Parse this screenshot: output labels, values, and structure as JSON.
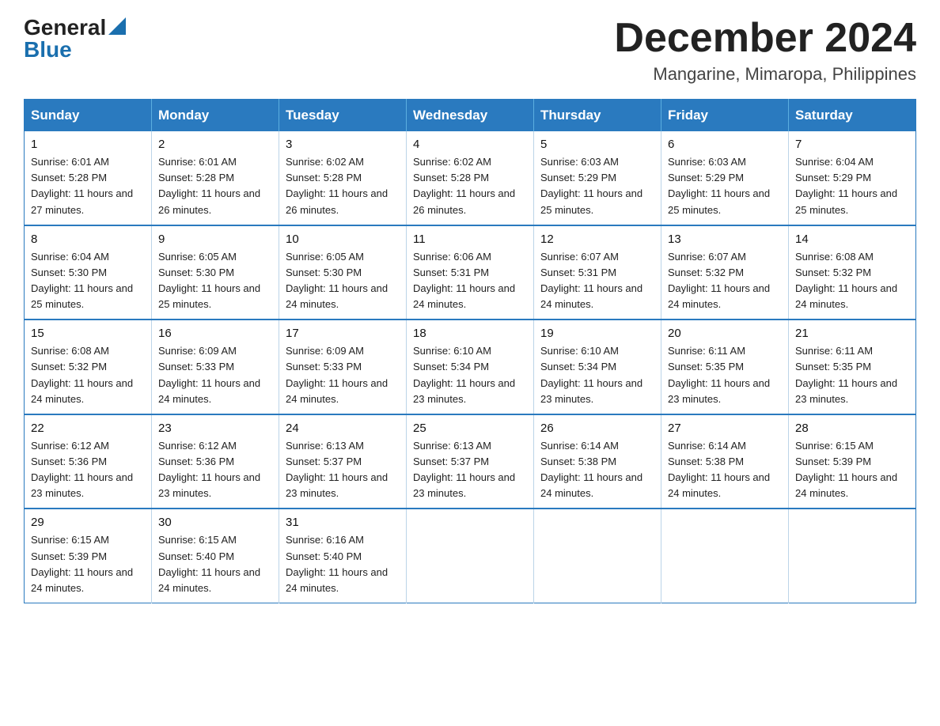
{
  "logo": {
    "general": "General",
    "blue": "Blue"
  },
  "title": "December 2024",
  "location": "Mangarine, Mimaropa, Philippines",
  "weekdays": [
    "Sunday",
    "Monday",
    "Tuesday",
    "Wednesday",
    "Thursday",
    "Friday",
    "Saturday"
  ],
  "weeks": [
    [
      {
        "day": "1",
        "sunrise": "6:01 AM",
        "sunset": "5:28 PM",
        "daylight": "11 hours and 27 minutes."
      },
      {
        "day": "2",
        "sunrise": "6:01 AM",
        "sunset": "5:28 PM",
        "daylight": "11 hours and 26 minutes."
      },
      {
        "day": "3",
        "sunrise": "6:02 AM",
        "sunset": "5:28 PM",
        "daylight": "11 hours and 26 minutes."
      },
      {
        "day": "4",
        "sunrise": "6:02 AM",
        "sunset": "5:28 PM",
        "daylight": "11 hours and 26 minutes."
      },
      {
        "day": "5",
        "sunrise": "6:03 AM",
        "sunset": "5:29 PM",
        "daylight": "11 hours and 25 minutes."
      },
      {
        "day": "6",
        "sunrise": "6:03 AM",
        "sunset": "5:29 PM",
        "daylight": "11 hours and 25 minutes."
      },
      {
        "day": "7",
        "sunrise": "6:04 AM",
        "sunset": "5:29 PM",
        "daylight": "11 hours and 25 minutes."
      }
    ],
    [
      {
        "day": "8",
        "sunrise": "6:04 AM",
        "sunset": "5:30 PM",
        "daylight": "11 hours and 25 minutes."
      },
      {
        "day": "9",
        "sunrise": "6:05 AM",
        "sunset": "5:30 PM",
        "daylight": "11 hours and 25 minutes."
      },
      {
        "day": "10",
        "sunrise": "6:05 AM",
        "sunset": "5:30 PM",
        "daylight": "11 hours and 24 minutes."
      },
      {
        "day": "11",
        "sunrise": "6:06 AM",
        "sunset": "5:31 PM",
        "daylight": "11 hours and 24 minutes."
      },
      {
        "day": "12",
        "sunrise": "6:07 AM",
        "sunset": "5:31 PM",
        "daylight": "11 hours and 24 minutes."
      },
      {
        "day": "13",
        "sunrise": "6:07 AM",
        "sunset": "5:32 PM",
        "daylight": "11 hours and 24 minutes."
      },
      {
        "day": "14",
        "sunrise": "6:08 AM",
        "sunset": "5:32 PM",
        "daylight": "11 hours and 24 minutes."
      }
    ],
    [
      {
        "day": "15",
        "sunrise": "6:08 AM",
        "sunset": "5:32 PM",
        "daylight": "11 hours and 24 minutes."
      },
      {
        "day": "16",
        "sunrise": "6:09 AM",
        "sunset": "5:33 PM",
        "daylight": "11 hours and 24 minutes."
      },
      {
        "day": "17",
        "sunrise": "6:09 AM",
        "sunset": "5:33 PM",
        "daylight": "11 hours and 24 minutes."
      },
      {
        "day": "18",
        "sunrise": "6:10 AM",
        "sunset": "5:34 PM",
        "daylight": "11 hours and 23 minutes."
      },
      {
        "day": "19",
        "sunrise": "6:10 AM",
        "sunset": "5:34 PM",
        "daylight": "11 hours and 23 minutes."
      },
      {
        "day": "20",
        "sunrise": "6:11 AM",
        "sunset": "5:35 PM",
        "daylight": "11 hours and 23 minutes."
      },
      {
        "day": "21",
        "sunrise": "6:11 AM",
        "sunset": "5:35 PM",
        "daylight": "11 hours and 23 minutes."
      }
    ],
    [
      {
        "day": "22",
        "sunrise": "6:12 AM",
        "sunset": "5:36 PM",
        "daylight": "11 hours and 23 minutes."
      },
      {
        "day": "23",
        "sunrise": "6:12 AM",
        "sunset": "5:36 PM",
        "daylight": "11 hours and 23 minutes."
      },
      {
        "day": "24",
        "sunrise": "6:13 AM",
        "sunset": "5:37 PM",
        "daylight": "11 hours and 23 minutes."
      },
      {
        "day": "25",
        "sunrise": "6:13 AM",
        "sunset": "5:37 PM",
        "daylight": "11 hours and 23 minutes."
      },
      {
        "day": "26",
        "sunrise": "6:14 AM",
        "sunset": "5:38 PM",
        "daylight": "11 hours and 24 minutes."
      },
      {
        "day": "27",
        "sunrise": "6:14 AM",
        "sunset": "5:38 PM",
        "daylight": "11 hours and 24 minutes."
      },
      {
        "day": "28",
        "sunrise": "6:15 AM",
        "sunset": "5:39 PM",
        "daylight": "11 hours and 24 minutes."
      }
    ],
    [
      {
        "day": "29",
        "sunrise": "6:15 AM",
        "sunset": "5:39 PM",
        "daylight": "11 hours and 24 minutes."
      },
      {
        "day": "30",
        "sunrise": "6:15 AM",
        "sunset": "5:40 PM",
        "daylight": "11 hours and 24 minutes."
      },
      {
        "day": "31",
        "sunrise": "6:16 AM",
        "sunset": "5:40 PM",
        "daylight": "11 hours and 24 minutes."
      },
      null,
      null,
      null,
      null
    ]
  ],
  "labels": {
    "sunrise": "Sunrise:",
    "sunset": "Sunset:",
    "daylight": "Daylight:"
  }
}
